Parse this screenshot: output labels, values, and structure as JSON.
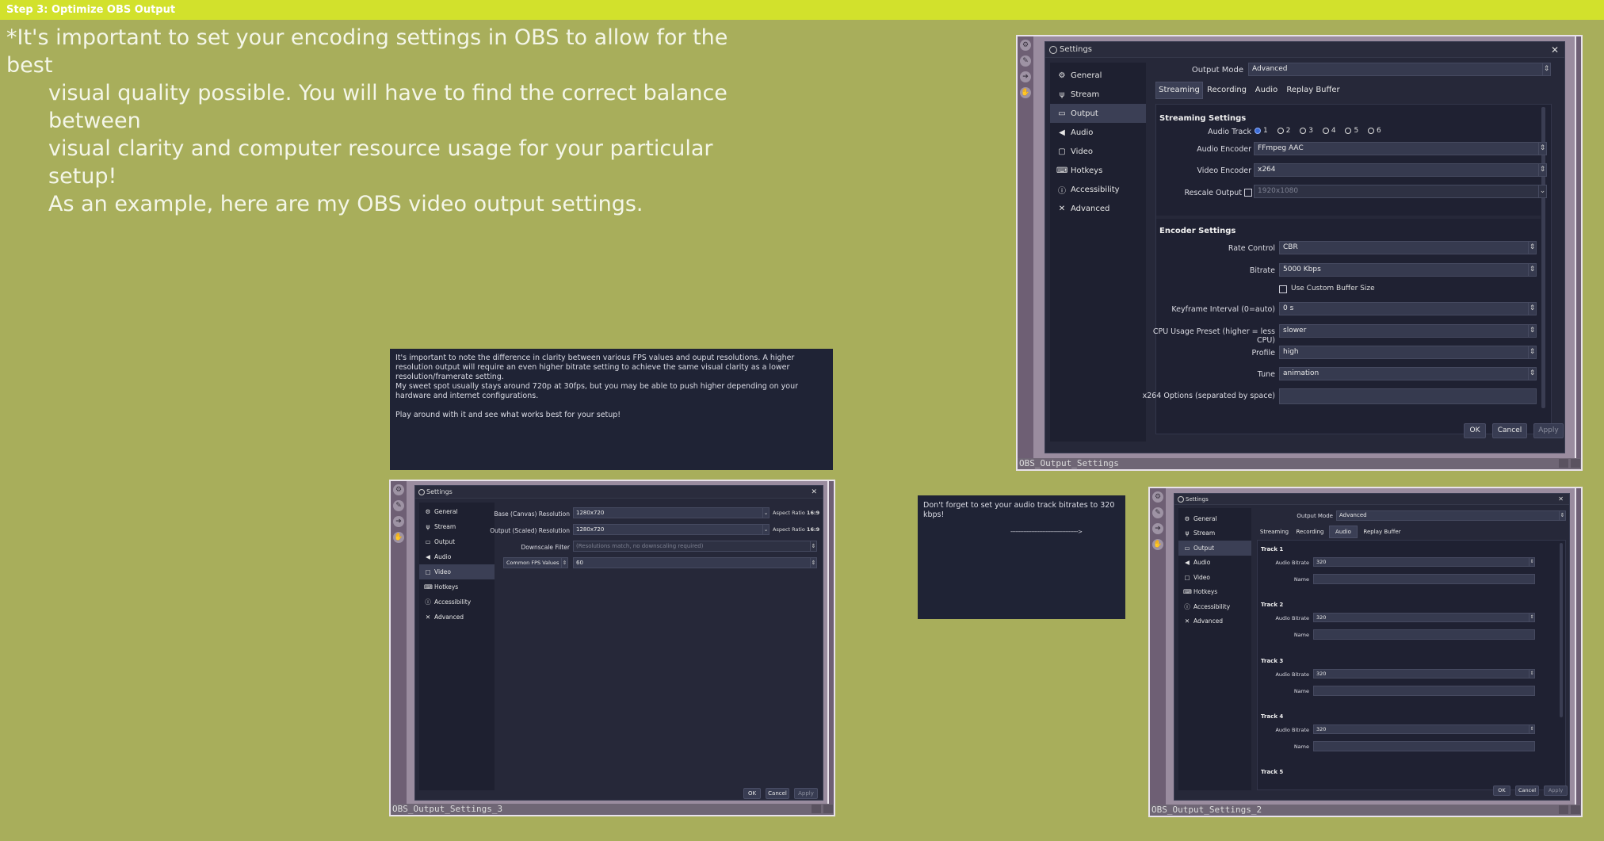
{
  "header": {
    "step_title": "Step 3: Optimize OBS Output"
  },
  "intro": {
    "line1": "*It's important to set your encoding settings in OBS to allow for the best",
    "line2": "visual quality possible. You will have to find the correct balance between",
    "line3": "visual clarity and computer resource usage for your particular setup!",
    "line4": "As an example, here are my OBS video output settings."
  },
  "note_fps": {
    "p1": "It's important to note the difference in clarity between various FPS values and ouput resolutions. A higher resolution output will require an even higher bitrate setting to achieve the same visual clarity as a lower resolution/framerate setting.",
    "p2": "My sweet spot usually stays around 720p at 30fps, but you may be able to push higher depending on your hardware and internet configurations.",
    "p3": "Play around with it and see what works best for your setup!"
  },
  "note_audio": {
    "text": "Don't forget to set your audio track bitrates to 320 kbps!",
    "arrow": "------------------------------------------>"
  },
  "sidebar": [
    "General",
    "Stream",
    "Output",
    "Audio",
    "Video",
    "Hotkeys",
    "Accessibility",
    "Advanced"
  ],
  "main_window": {
    "caption": "OBS_Output_Settings",
    "title": "Settings",
    "close": "✕",
    "output_mode_label": "Output Mode",
    "output_mode_value": "Advanced",
    "tabs": [
      "Streaming",
      "Recording",
      "Audio",
      "Replay Buffer"
    ],
    "streaming_section": "Streaming Settings",
    "audio_track_label": "Audio Track",
    "audio_tracks": [
      "1",
      "2",
      "3",
      "4",
      "5",
      "6"
    ],
    "audio_encoder_label": "Audio Encoder",
    "audio_encoder_value": "FFmpeg AAC",
    "video_encoder_label": "Video Encoder",
    "video_encoder_value": "x264",
    "rescale_label": "Rescale Output",
    "rescale_value": "1920x1080",
    "encoder_section": "Encoder Settings",
    "rate_control_label": "Rate Control",
    "rate_control_value": "CBR",
    "bitrate_label": "Bitrate",
    "bitrate_value": "5000 Kbps",
    "custom_buffer_label": "Use Custom Buffer Size",
    "keyframe_label": "Keyframe Interval (0=auto)",
    "keyframe_value": "0 s",
    "cpu_preset_label": "CPU Usage Preset (higher = less CPU)",
    "cpu_preset_value": "slower",
    "profile_label": "Profile",
    "profile_value": "high",
    "tune_label": "Tune",
    "tune_value": "animation",
    "x264_options_label": "x264 Options (separated by space)",
    "x264_options_value": "",
    "ok": "OK",
    "cancel": "Cancel",
    "apply": "Apply"
  },
  "video_window": {
    "caption": "OBS_Output_Settings_3",
    "title": "Settings",
    "close": "✕",
    "base_res_label": "Base (Canvas) Resolution",
    "base_res_value": "1280x720",
    "output_res_label": "Output (Scaled) Resolution",
    "output_res_value": "1280x720",
    "aspect_label": "Aspect Ratio",
    "aspect_value": "16:9",
    "downscale_label": "Downscale Filter",
    "downscale_value": "(Resolutions match, no downscaling required)",
    "fps_label": "Common FPS Values",
    "fps_value": "60",
    "ok": "OK",
    "cancel": "Cancel",
    "apply": "Apply"
  },
  "audio_window": {
    "caption": "OBS_Output_Settings_2",
    "title": "Settings",
    "close": "✕",
    "output_mode_label": "Output Mode",
    "output_mode_value": "Advanced",
    "tabs": [
      "Streaming",
      "Recording",
      "Audio",
      "Replay Buffer"
    ],
    "tracks": [
      {
        "title": "Track 1",
        "bitrate_label": "Audio Bitrate",
        "bitrate_value": "320",
        "name_label": "Name"
      },
      {
        "title": "Track 2",
        "bitrate_label": "Audio Bitrate",
        "bitrate_value": "320",
        "name_label": "Name"
      },
      {
        "title": "Track 3",
        "bitrate_label": "Audio Bitrate",
        "bitrate_value": "320",
        "name_label": "Name"
      },
      {
        "title": "Track 4",
        "bitrate_label": "Audio Bitrate",
        "bitrate_value": "320",
        "name_label": "Name"
      }
    ],
    "track5_title": "Track 5",
    "ok": "OK",
    "cancel": "Cancel",
    "apply": "Apply"
  },
  "colors": {
    "background": "#a8ae5b",
    "header_bar": "#d2e12c",
    "window_bg": "#262839",
    "sidebar_bg": "#1e2030",
    "frame": "#9a8c9f"
  },
  "icons": [
    "gear-icon",
    "antenna-icon",
    "output-icon",
    "speaker-icon",
    "monitor-icon",
    "keyboard-icon",
    "info-icon",
    "tools-icon"
  ]
}
